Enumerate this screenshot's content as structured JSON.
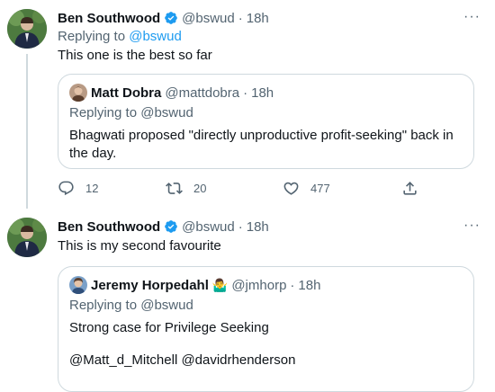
{
  "tweet1": {
    "author_name": "Ben Southwood",
    "handle": "@bswud",
    "time": "18h",
    "replying_label": "Replying to",
    "replying_mention": "@bswud",
    "text": "This one is the best so far",
    "quote": {
      "author_name": "Matt Dobra",
      "handle": "@mattdobra",
      "time": "18h",
      "replying": "Replying to @bswud",
      "text": "Bhagwati proposed \"directly unproductive profit-seeking\" back in the day."
    },
    "stats": {
      "replies": "12",
      "retweets": "20",
      "likes": "477"
    }
  },
  "tweet2": {
    "author_name": "Ben Southwood",
    "handle": "@bswud",
    "time": "18h",
    "text": "This is my second favourite",
    "quote": {
      "author_name": "Jeremy Horpedahl",
      "emoji": "🤷‍♂️",
      "handle": "@jmhorp",
      "time": "18h",
      "replying": "Replying to @bswud",
      "text1": "Strong case for Privilege Seeking",
      "text2": "@Matt_d_Mitchell @davidrhenderson"
    }
  },
  "ui": {
    "dot": "·",
    "more": "···"
  },
  "colors": {
    "accent": "#1d9bf0",
    "muted": "#536471",
    "border": "#cfd9de"
  }
}
